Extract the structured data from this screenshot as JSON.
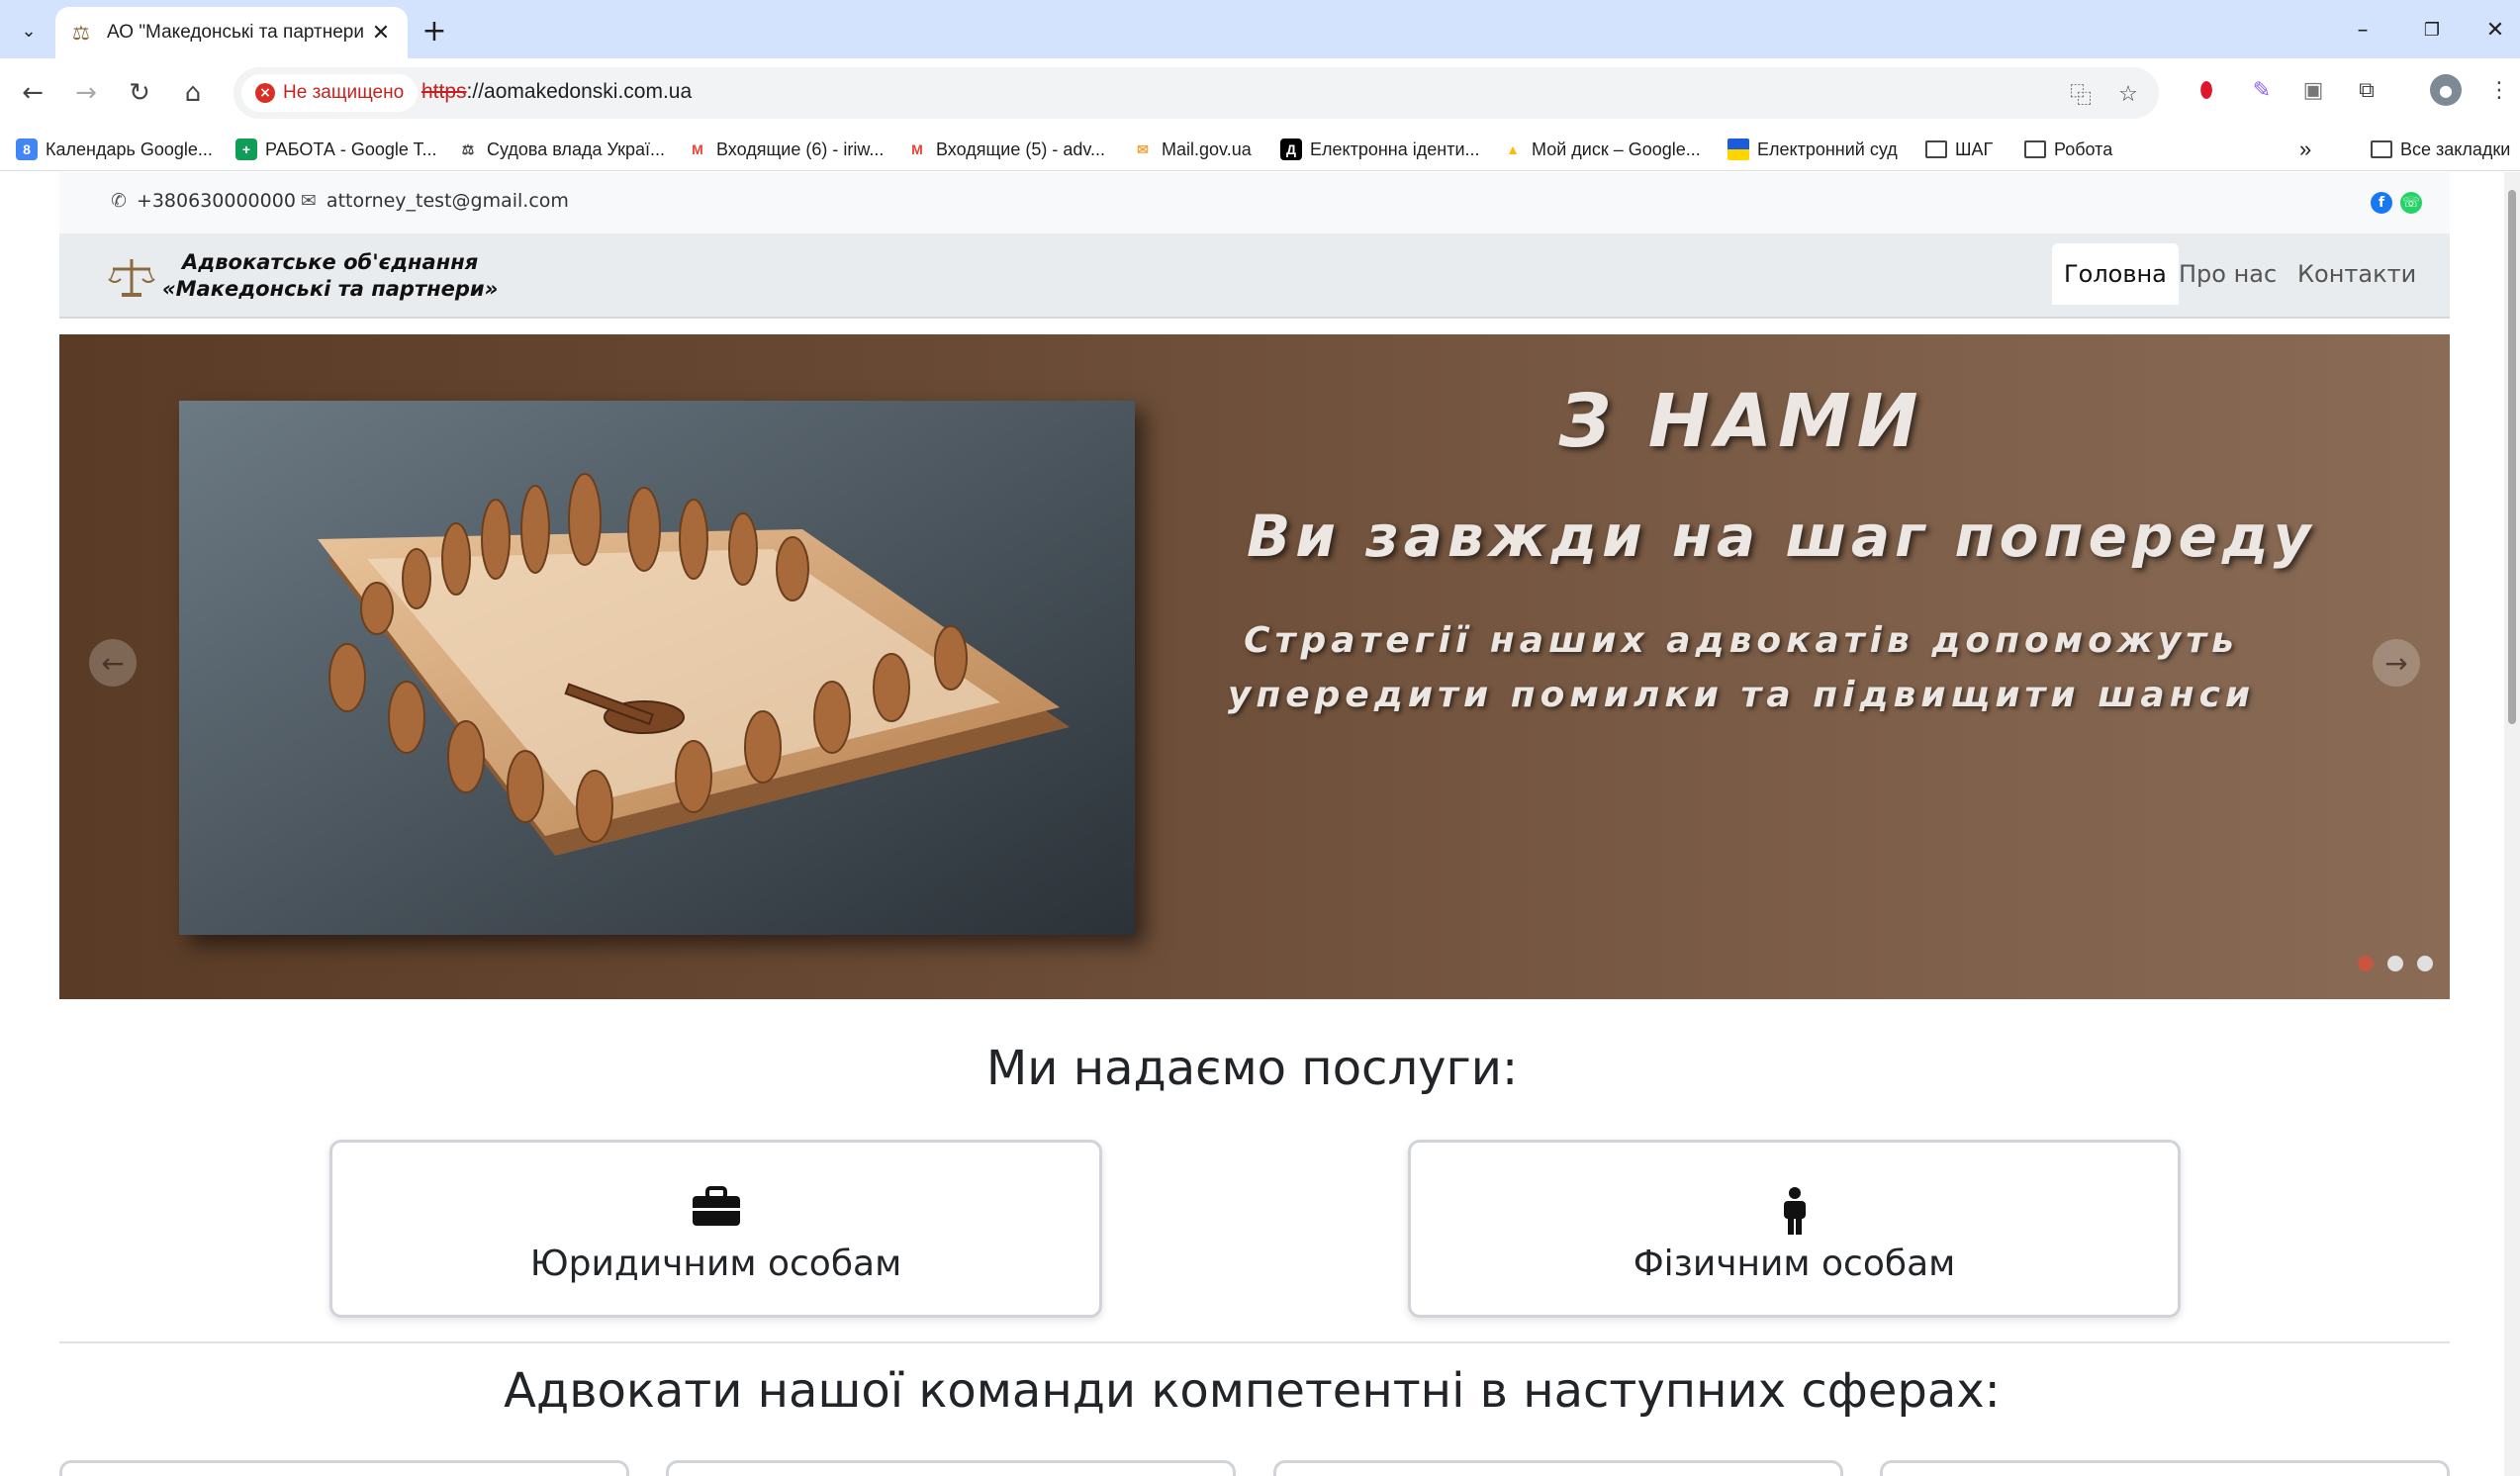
{
  "browser": {
    "tab_title": "АО \"Македонські та партнери",
    "security_label": "Не защищено",
    "url_scheme": "https",
    "url_rest": "://aomakedonski.com.ua"
  },
  "bookmarks": [
    {
      "label": "Календарь Google...",
      "icon_color": "#4285f4",
      "icon_text": "8"
    },
    {
      "label": "РАБОТА - Google T...",
      "icon_color": "#0f9d58",
      "icon_text": "+"
    },
    {
      "label": "Судова влада Украї...",
      "icon_color": "#444444",
      "icon_text": "⚖"
    },
    {
      "label": "Входящие (6) - iriw...",
      "icon_color": "#ea4335",
      "icon_text": "M"
    },
    {
      "label": "Входящие (5) - adv...",
      "icon_color": "#ea4335",
      "icon_text": "M"
    },
    {
      "label": "Mail.gov.ua",
      "icon_color": "#f4a236",
      "icon_text": "✉"
    },
    {
      "label": "Електронна іденти...",
      "icon_color": "#000000",
      "icon_text": "Д"
    },
    {
      "label": "Мой диск – Google...",
      "icon_color": "#fbbc04",
      "icon_text": "▲"
    },
    {
      "label": "Електронний суд",
      "icon_color": "#ffd500",
      "icon_text": ""
    },
    {
      "label": "ШАГ",
      "icon_color": "folder",
      "icon_text": ""
    },
    {
      "label": "Робота",
      "icon_color": "folder",
      "icon_text": ""
    }
  ],
  "all_bookmarks": "Все закладки",
  "site": {
    "phone": "+380630000000",
    "email": "attorney_test@gmail.com",
    "brand_line1": "Адвокатське об'єднання",
    "brand_line2": "«Македонські та партнери»",
    "nav": [
      "Головна",
      "Про нас",
      "Контакти"
    ],
    "hero": {
      "heading": "З НАМИ",
      "subheading": "Ви завжди на шаг попереду",
      "text_line1": "Стратегії наших адвокатів допоможуть",
      "text_line2": "упередити помилки та підвищити шанси",
      "slides": 3,
      "active_slide": 1
    },
    "services_title": "Ми надаємо послуги:",
    "services": [
      {
        "label": "Юридичним особам",
        "icon": "briefcase-icon"
      },
      {
        "label": "Фізичним особам",
        "icon": "person-icon"
      }
    ],
    "areas_title": "Адвокати нашої команди компетентні в наступних сферах:",
    "colors": {
      "hero_dark": "#5a3c26",
      "hero_light": "#8a6c56",
      "indicator_active": "#c8553d",
      "facebook": "#1877f2",
      "whatsapp": "#25d366"
    }
  }
}
